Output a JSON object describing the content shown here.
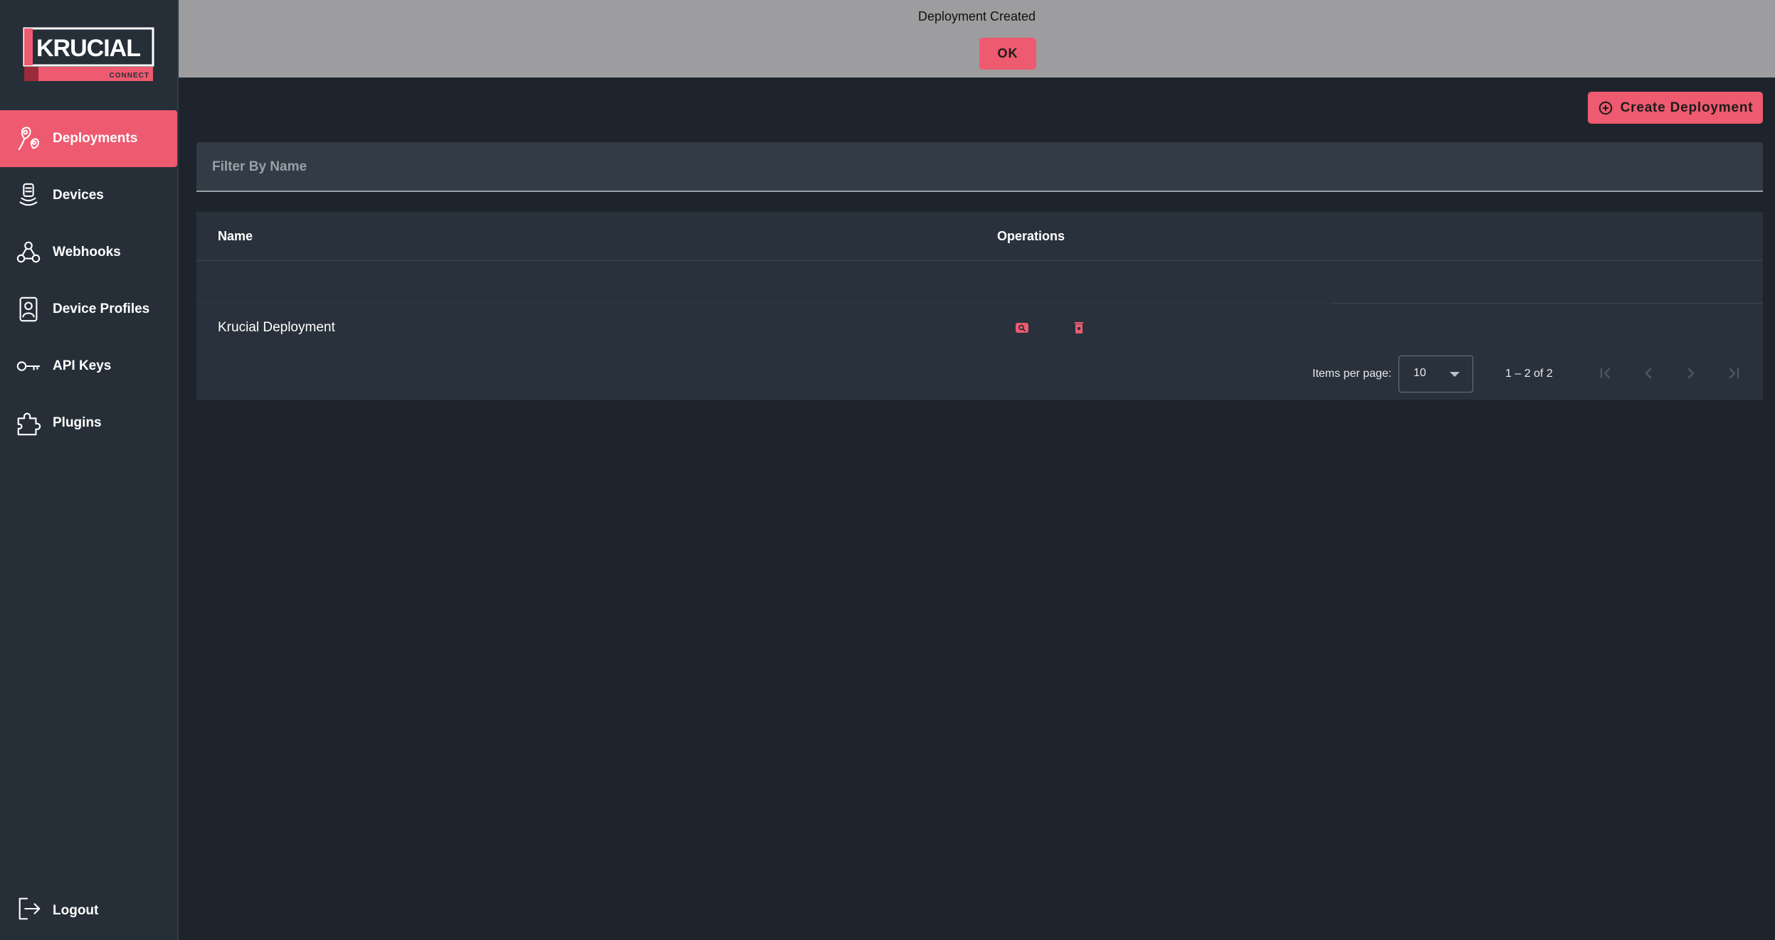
{
  "brand": {
    "name": "KRUCIAL",
    "tagline": "CONNECT",
    "color": "#ee5a6f"
  },
  "sidebar": {
    "items": [
      {
        "label": "Deployments",
        "icon": "map-pin-icon",
        "active": true
      },
      {
        "label": "Devices",
        "icon": "device-icon",
        "active": false
      },
      {
        "label": "Webhooks",
        "icon": "webhook-icon",
        "active": false
      },
      {
        "label": "Device Profiles",
        "icon": "profile-icon",
        "active": false
      },
      {
        "label": "API Keys",
        "icon": "key-icon",
        "active": false
      },
      {
        "label": "Plugins",
        "icon": "puzzle-icon",
        "active": false
      }
    ],
    "logout_label": "Logout"
  },
  "banner": {
    "message": "Deployment Created",
    "ok_label": "OK"
  },
  "toolbar": {
    "create_label": "Create Deployment"
  },
  "filter": {
    "placeholder": "Filter By Name",
    "value": ""
  },
  "table": {
    "columns": [
      "Name",
      "Operations"
    ],
    "rows": [
      {
        "name": "Krucial Deployment",
        "operations": [
          "view-icon",
          "delete-icon"
        ]
      }
    ]
  },
  "paginator": {
    "items_per_page_label": "Items per page:",
    "page_size": "10",
    "range": "1 – 2 of 2"
  }
}
